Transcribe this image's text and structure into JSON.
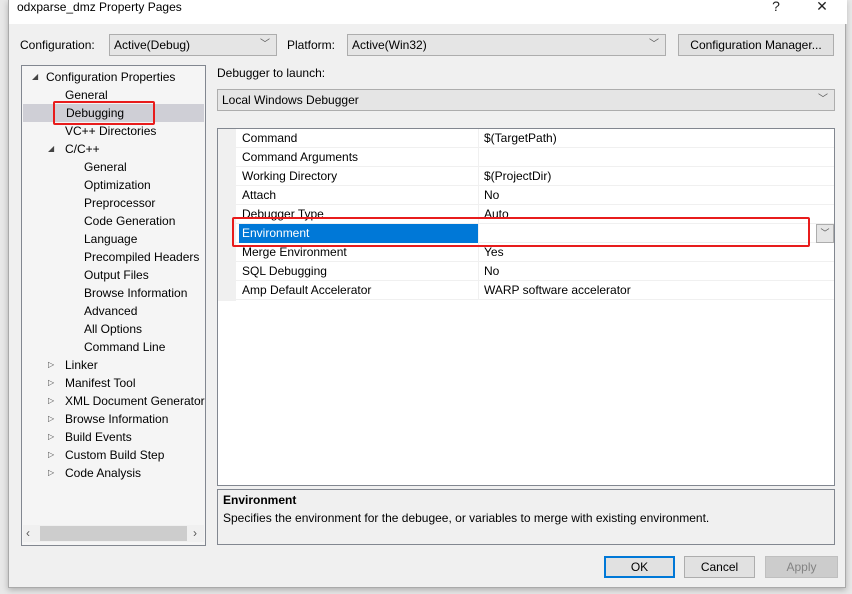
{
  "window": {
    "title": "odxparse_dmz Property Pages",
    "help_label": "?",
    "close_label": "✕"
  },
  "toolbar": {
    "configuration_label": "Configuration:",
    "configuration_value": "Active(Debug)",
    "platform_label": "Platform:",
    "platform_value": "Active(Win32)",
    "config_manager_label": "Configuration Manager..."
  },
  "tree": {
    "root": "Configuration Properties",
    "items": [
      {
        "label": "General"
      },
      {
        "label": "Debugging",
        "selected": true
      },
      {
        "label": "VC++ Directories"
      },
      {
        "label": "C/C++",
        "expanded": true
      },
      {
        "label": "General"
      },
      {
        "label": "Optimization"
      },
      {
        "label": "Preprocessor"
      },
      {
        "label": "Code Generation"
      },
      {
        "label": "Language"
      },
      {
        "label": "Precompiled Headers"
      },
      {
        "label": "Output Files"
      },
      {
        "label": "Browse Information"
      },
      {
        "label": "Advanced"
      },
      {
        "label": "All Options"
      },
      {
        "label": "Command Line"
      },
      {
        "label": "Linker"
      },
      {
        "label": "Manifest Tool"
      },
      {
        "label": "XML Document Generator"
      },
      {
        "label": "Browse Information"
      },
      {
        "label": "Build Events"
      },
      {
        "label": "Custom Build Step"
      },
      {
        "label": "Code Analysis"
      }
    ]
  },
  "debugger": {
    "label": "Debugger to launch:",
    "value": "Local Windows Debugger"
  },
  "properties": [
    {
      "name": "Command",
      "value": "$(TargetPath)"
    },
    {
      "name": "Command Arguments",
      "value": ""
    },
    {
      "name": "Working Directory",
      "value": "$(ProjectDir)"
    },
    {
      "name": "Attach",
      "value": "No"
    },
    {
      "name": "Debugger Type",
      "value": "Auto"
    },
    {
      "name": "Environment",
      "value": "",
      "selected": true
    },
    {
      "name": "Merge Environment",
      "value": "Yes"
    },
    {
      "name": "SQL Debugging",
      "value": "No"
    },
    {
      "name": "Amp Default Accelerator",
      "value": "WARP software accelerator"
    }
  ],
  "description": {
    "title": "Environment",
    "text": "Specifies the environment for the debugee, or variables to merge with existing environment."
  },
  "buttons": {
    "ok": "OK",
    "cancel": "Cancel",
    "apply": "Apply"
  },
  "colors": {
    "selection": "#0078d7",
    "highlight_box": "#e81c1c"
  }
}
